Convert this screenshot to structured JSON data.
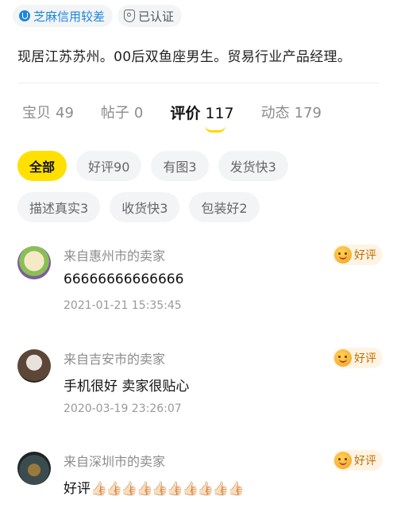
{
  "badges": [
    {
      "label": "芝麻信用较差",
      "icon": "credit-drop-icon",
      "color": "#1f86d9"
    },
    {
      "label": "已认证",
      "icon": "verified-shield-icon"
    }
  ],
  "profile": {
    "bio": "现居江苏苏州。00后双鱼座男生。贸易行业产品经理。"
  },
  "tabs": [
    {
      "label": "宝贝",
      "count": "49"
    },
    {
      "label": "帖子",
      "count": "0"
    },
    {
      "label": "评价",
      "count": "117",
      "active": true
    },
    {
      "label": "动态",
      "count": "179"
    }
  ],
  "filters": [
    {
      "label": "全部",
      "active": true
    },
    {
      "label": "好评90"
    },
    {
      "label": "有图3"
    },
    {
      "label": "发货快3"
    },
    {
      "label": "描述真实3"
    },
    {
      "label": "收货快3"
    },
    {
      "label": "包装好2"
    }
  ],
  "reviews": [
    {
      "seller": "来自惠州市的卖家",
      "content": "66666666666666",
      "date": "2021-01-21 15:35:45",
      "tag": "好评"
    },
    {
      "seller": "来自吉安市的卖家",
      "content": "手机很好 卖家很贴心",
      "date": "2020-03-19 23:26:07",
      "tag": "好评"
    },
    {
      "seller": "来自深圳市的卖家",
      "content": "好评",
      "emoji": "👍🏻👍🏻👍🏻👍🏻👍🏻👍🏻👍🏻👍🏻👍🏻👍🏻",
      "tag": "好评"
    }
  ],
  "colors": {
    "accent": "#ffe000",
    "credit": "#1f86d9",
    "tag_bg": "#fff4e4"
  }
}
